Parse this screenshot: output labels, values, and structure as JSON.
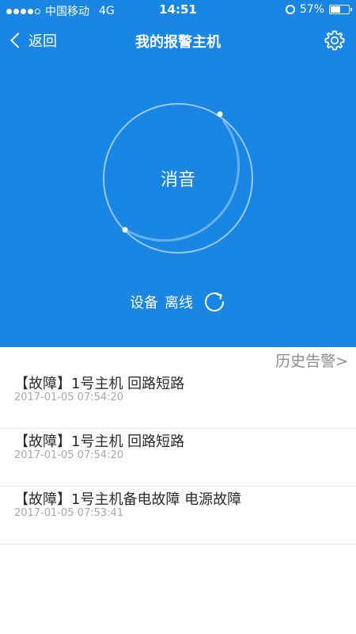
{
  "status_bar": {
    "carrier": "中国移动",
    "network": "4G",
    "time": "14:51",
    "battery_text": "57%",
    "battery_level": 0.57
  },
  "nav": {
    "back_label": "返回",
    "title": "我的报警主机"
  },
  "hero": {
    "mute_label": "消音",
    "device_label": "设备",
    "device_state": "离线"
  },
  "history": {
    "link_label": "历史告警>"
  },
  "alarms": [
    {
      "title": "【故障】1号主机 回路短路",
      "time": "2017-01-05 07:54:20"
    },
    {
      "title": "【故障】1号主机 回路短路",
      "time": "2017-01-05 07:54:20"
    },
    {
      "title": "【故障】1号主机备电故障 电源故障",
      "time": "2017-01-05 07:53:41"
    }
  ],
  "colors": {
    "primary_blue": "#1a86e3",
    "white": "#ffffff",
    "title_text": "#2c2c2c",
    "time_text": "#a8a8a8",
    "history_text": "#8e8e8e",
    "divider": "#e4e4e4"
  },
  "icons": {
    "back": "chevron-left-icon",
    "settings": "gear-icon",
    "refresh": "refresh-icon",
    "alarm_clock": "alarm-clock-icon",
    "battery": "battery-icon"
  }
}
